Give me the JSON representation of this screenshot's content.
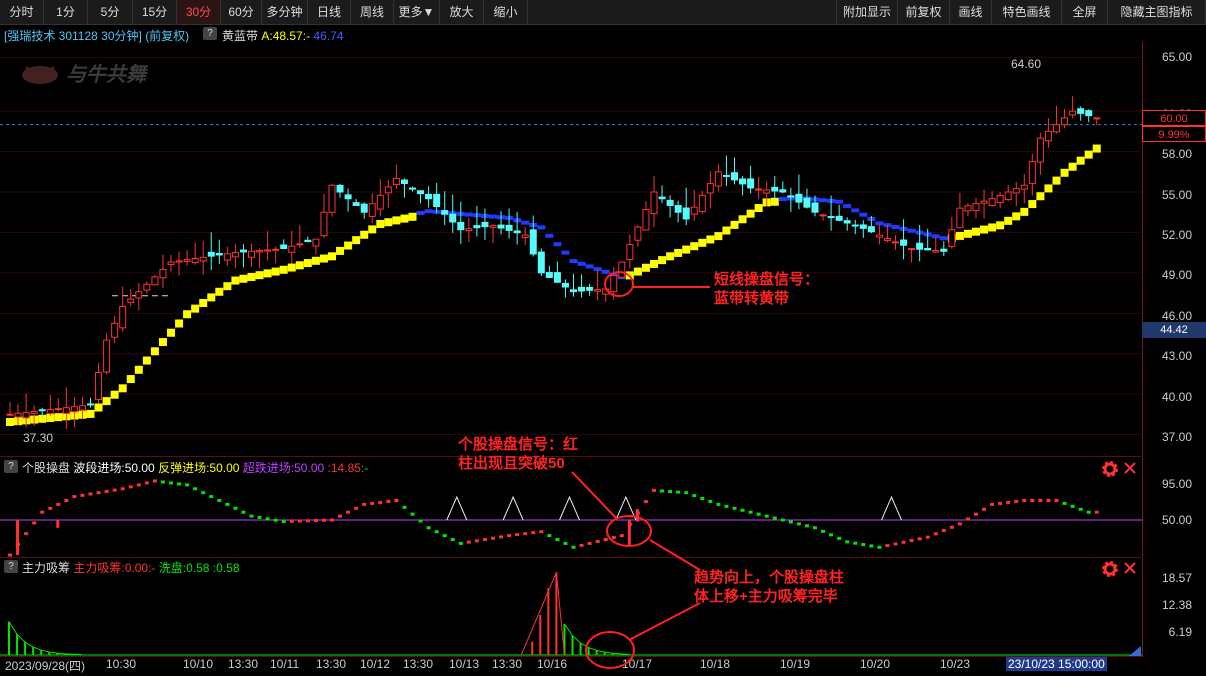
{
  "toolbar": {
    "left": [
      "分时",
      "1分",
      "5分",
      "15分",
      "30分",
      "60分",
      "多分钟",
      "日线",
      "周线",
      "更多▼",
      "放大",
      "缩小"
    ],
    "right": [
      "附加显示",
      "前复权",
      "画线",
      "特色画线",
      "全屏",
      "隐藏主图指标"
    ],
    "active": "30分"
  },
  "header": {
    "stock": "[强瑞技术 301128 30分钟]",
    "adjust": "(前复权)",
    "help": "?",
    "ind_name": "黄蓝带",
    "ind_val1": "A:48.57",
    "ind_sep": ":-",
    "ind_val2": "46.74"
  },
  "watermark": "与牛共舞",
  "price_axis": {
    "labels": [
      "65.00",
      "61.00",
      "58.00",
      "55.00",
      "52.00",
      "49.00",
      "46.00",
      "43.00",
      "40.00",
      "37.00"
    ],
    "current_price": "60.00",
    "current_pct": "9.99%",
    "marker_price": "44.42",
    "high_label": "64.60",
    "low_label": "37.30"
  },
  "panel2": {
    "help": "?",
    "name": "个股操盘",
    "v1": "波段进场:50.00",
    "v2": "反弹进场:50.00",
    "v3": "超跌进场:50.00",
    "v4": ":14.85",
    "v5": ":-",
    "axis": [
      "95.00",
      "50.00"
    ]
  },
  "panel3": {
    "help": "?",
    "name": "主力吸筹",
    "v1": "主力吸筹:0.00",
    "v2": ":-",
    "v3": "洗盘:0.58",
    "v4": ":0.58",
    "axis": [
      "18.57",
      "12.38",
      "6.19"
    ]
  },
  "annotations": {
    "a1_line1": "短线操盘信号：",
    "a1_line2": "蓝带转黄带",
    "a2_line1": "个股操盘信号：红",
    "a2_line2": "柱出现且突破50",
    "a3_line1": "趋势向上，个股操盘柱",
    "a3_line2": "体上移+主力吸筹完毕"
  },
  "xaxis": [
    "2023/09/28(四)",
    "10:30",
    "10/10",
    "13:30",
    "10/11",
    "13:30",
    "10/12",
    "13:30",
    "10/13",
    "13:30",
    "10/16",
    "10/17",
    "10/18",
    "10/19",
    "10/20",
    "10/23",
    "23/10/23 15:00:00"
  ],
  "colors": {
    "up": "#ff3232",
    "down": "#54fcfc",
    "yellow": "#ffff00",
    "blue": "#1f3bff",
    "magenta": "#c040ff",
    "green": "#00e600"
  }
}
